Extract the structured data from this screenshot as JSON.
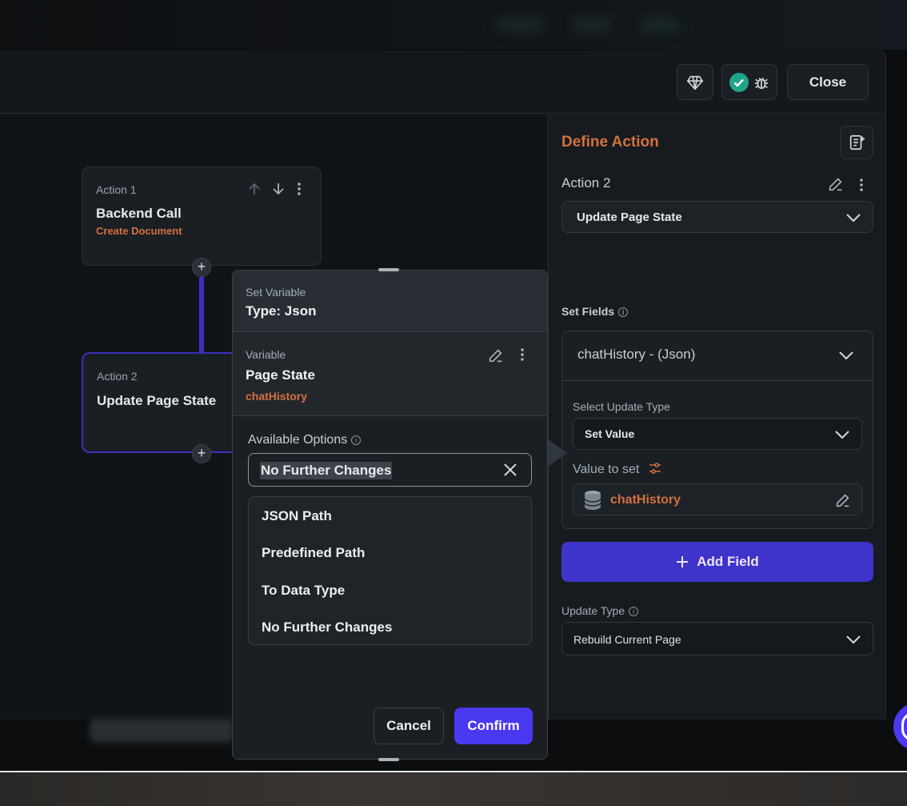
{
  "header": {
    "close_label": "Close"
  },
  "canvas": {
    "action1": {
      "label": "Action 1",
      "title": "Backend Call",
      "subtitle": "Create Document"
    },
    "action2": {
      "label": "Action 2",
      "title": "Update Page State"
    },
    "add_symbol": "+"
  },
  "popup": {
    "head_label": "Set Variable",
    "head_type": "Type: Json",
    "variable_label": "Variable",
    "variable_source": "Page State",
    "variable_name": "chatHistory",
    "options_label": "Available Options",
    "search_value": "No Further Changes",
    "options": [
      {
        "label": "JSON Path"
      },
      {
        "label": "Predefined Path"
      },
      {
        "label": "To Data Type"
      },
      {
        "label": "No Further Changes"
      }
    ],
    "cancel_label": "Cancel",
    "confirm_label": "Confirm"
  },
  "panel": {
    "title": "Define Action",
    "action_name": "Action 2",
    "action_type": "Update Page State",
    "set_fields_label": "Set Fields",
    "field_selected": "chatHistory - (Json)",
    "select_update_type_label": "Select Update Type",
    "select_update_type_value": "Set Value",
    "value_to_set_label": "Value to set",
    "value_to_set": "chatHistory",
    "add_field_label": "Add Field",
    "update_type_label": "Update Type",
    "update_type_value": "Rebuild Current Page"
  },
  "colors": {
    "accent": "#4b39ef",
    "orange": "#d4703f",
    "status_ok": "#21a58a"
  },
  "icons": [
    "gem-icon",
    "check-circle-icon",
    "bug-icon",
    "notes-icon",
    "pencil-icon",
    "more-vertical-icon",
    "arrow-up-icon",
    "arrow-down-icon",
    "chevron-down-icon",
    "close-icon",
    "info-icon",
    "database-icon",
    "sliders-icon",
    "plus-icon"
  ]
}
